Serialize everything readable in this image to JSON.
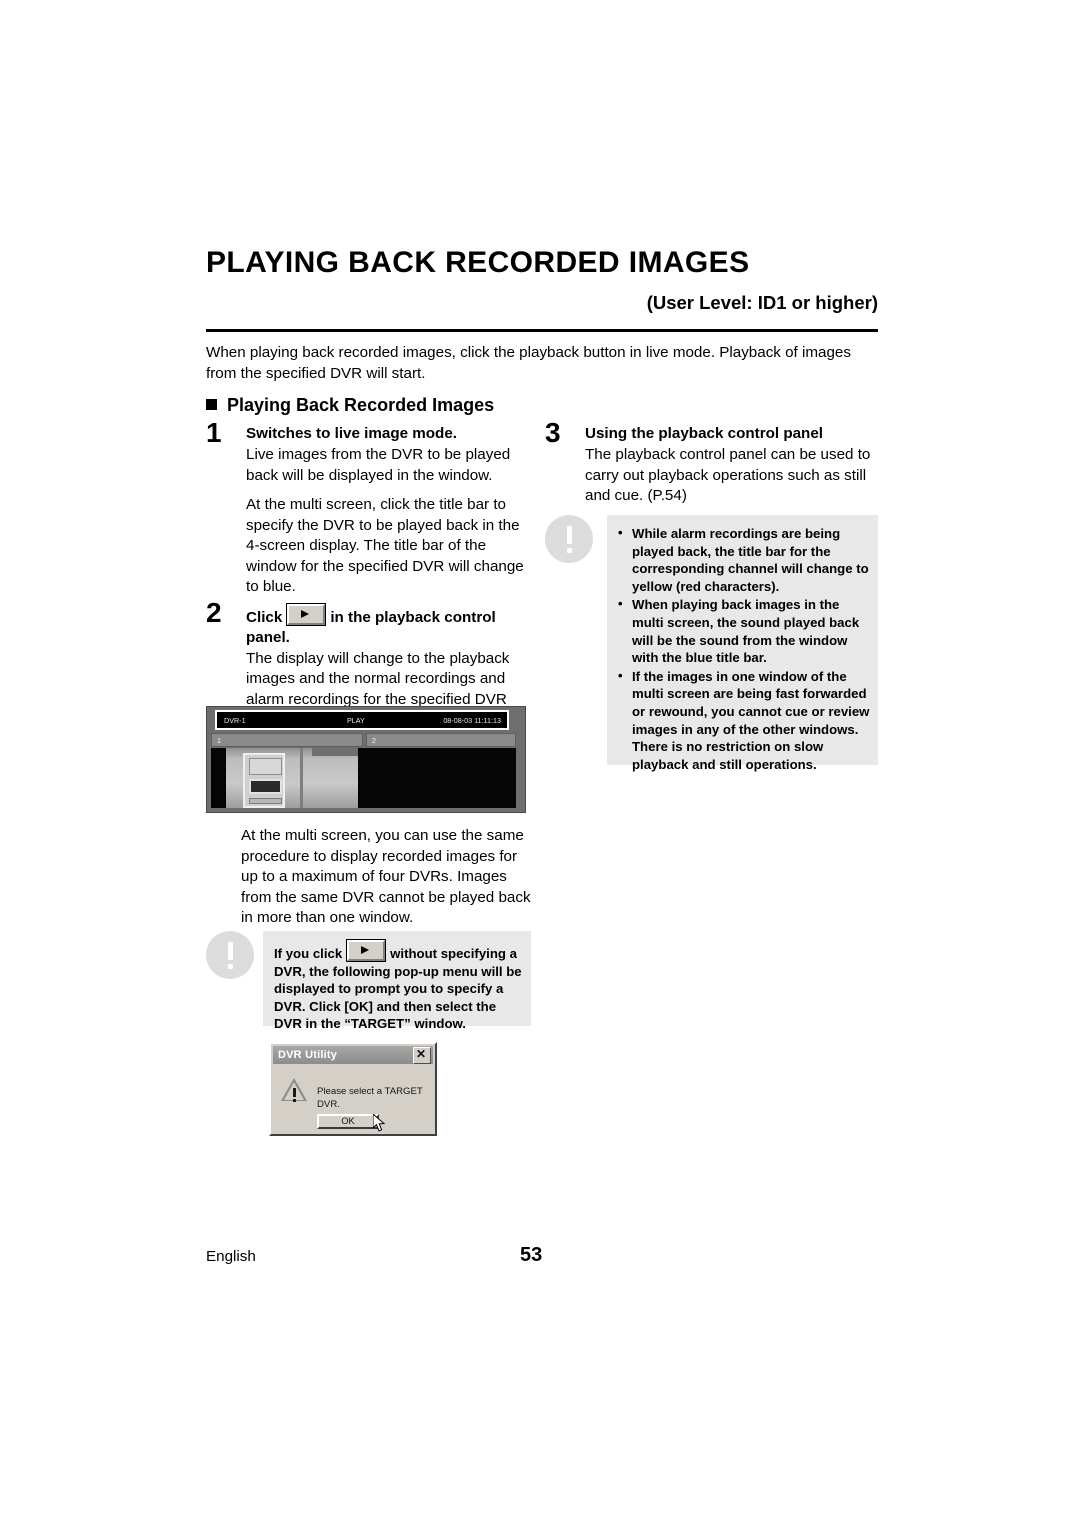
{
  "document": {
    "title": "PLAYING BACK RECORDED IMAGES",
    "user_level": "(User Level: ID1 or higher)",
    "intro": "When playing back recorded images, click the playback button in live mode. Playback of images from the specified DVR will start.",
    "section_heading": "Playing Back Recorded Images"
  },
  "steps": {
    "step1": {
      "number": "1",
      "title": "Switches to live image mode.",
      "para1": "Live images from the DVR to be played back will be displayed in the window.",
      "para2": "At the multi screen, click the title bar to specify the DVR to be played back in the 4-screen display. The title bar of the window for the specified DVR will change to blue."
    },
    "step2": {
      "number": "2",
      "title_before": "Click",
      "title_after": "in the playback control panel.",
      "body": "The display will change to the playback images and the normal recordings and alarm recordings for the specified DVR will be played back in order. The image mode display in the title bar will also change from “LIVE” to “PLAY”.",
      "after_screenshot": "At the multi screen, you can use the same procedure to display recorded images for up to a maximum of four DVRs. Images from the same DVR cannot be played back in more than one window."
    },
    "step3": {
      "number": "3",
      "title": "Using the playback control panel",
      "body": "The playback control panel can be used to carry out playback operations such as still and cue. (P.54)"
    }
  },
  "dvr_screenshot": {
    "title_name": "DVR-1",
    "title_mode": "PLAY",
    "title_time": "08-08-03 11:11:13",
    "channel1": "1",
    "channel2": "2"
  },
  "note_left": {
    "text_before": "If you click",
    "text_after": "without specifying a DVR, the following pop-up menu will be displayed to prompt you to specify a DVR. Click [OK] and then select the DVR in the “TARGET” window."
  },
  "note_right": {
    "bullets": [
      "While alarm recordings are being played back, the title bar for the corresponding channel will change to yellow (red characters).",
      "When playing back images in the multi screen, the sound played back will be the sound from the window with the blue title bar.",
      "If the images in one window of the multi screen are being fast forwarded or rewound, you cannot cue or review images in any of the other windows. There is no restriction on slow playback and still operations."
    ]
  },
  "dialog": {
    "title": "DVR Utility",
    "close_glyph": "✕",
    "message": "Please select  a TARGET DVR.",
    "ok_label": "OK"
  },
  "footer": {
    "language": "English",
    "page_number": "53"
  },
  "colors": {
    "note_background": "#e8e8e8",
    "note_icon": "#dcdcdc",
    "dialog_face": "#d4d0c8"
  }
}
